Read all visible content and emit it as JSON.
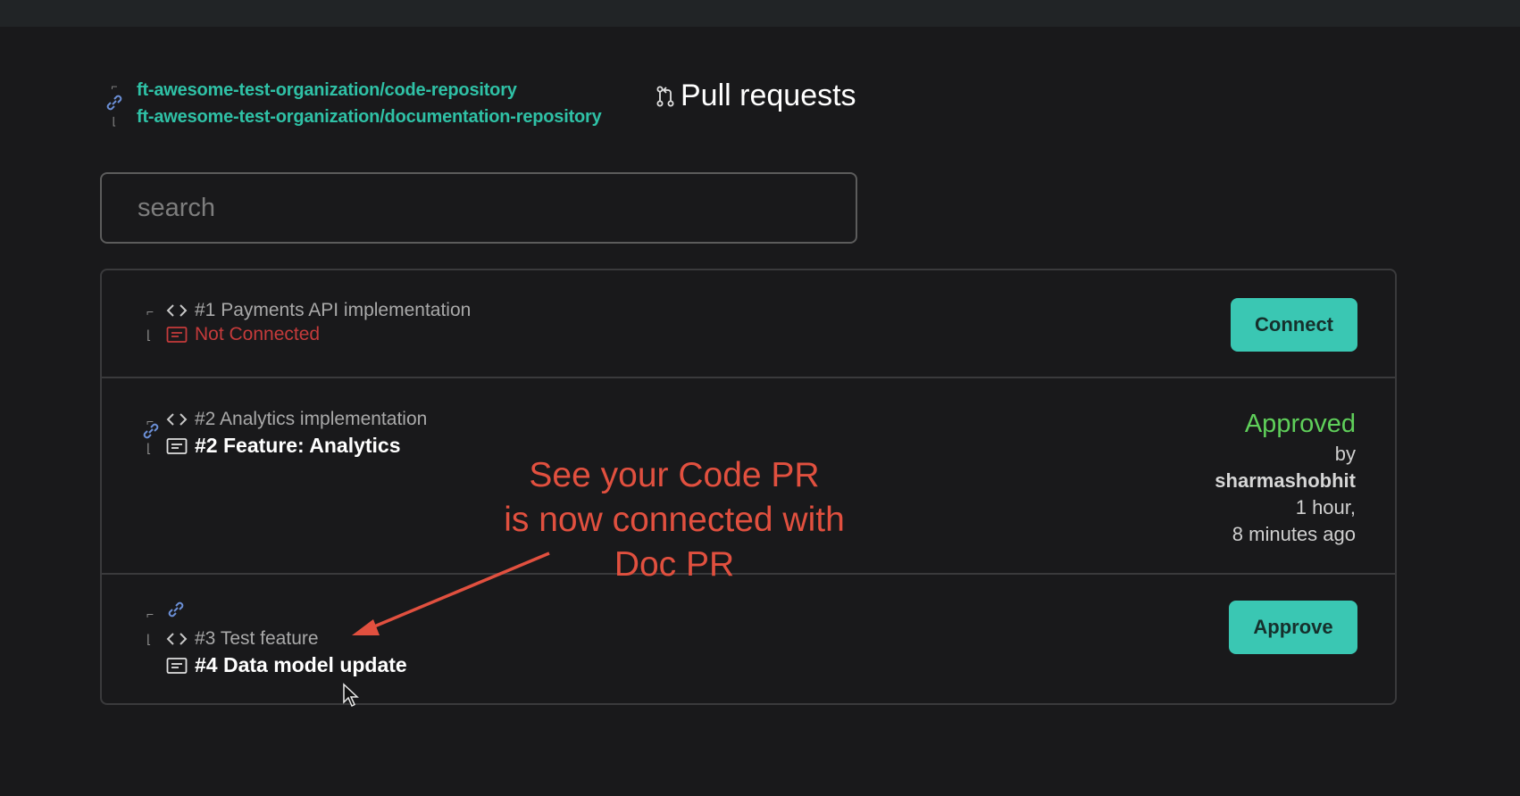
{
  "header": {
    "repos": [
      "ft-awesome-test-organization/code-repository",
      "ft-awesome-test-organization/documentation-repository"
    ],
    "title": "Pull requests"
  },
  "search": {
    "placeholder": "search"
  },
  "pull_requests": [
    {
      "code_pr": "#1 Payments API implementation",
      "status_text": "Not Connected",
      "action_label": "Connect"
    },
    {
      "code_pr": "#2 Analytics implementation",
      "doc_pr": "#2 Feature: Analytics",
      "review": {
        "status": "Approved",
        "by_label": "by",
        "approver": "sharmashobhit",
        "time_line1": "1 hour,",
        "time_line2": "8 minutes ago"
      }
    },
    {
      "code_pr": "#3 Test feature",
      "doc_pr": "#4 Data model update",
      "action_label": "Approve"
    }
  ],
  "annotation": {
    "lines": [
      "See your Code PR",
      "is now connected with",
      "Doc PR"
    ],
    "color": "#e1503f"
  },
  "colors": {
    "accent": "#3ac7b3",
    "repo_link": "#2fc1a6",
    "approved": "#5fcf5a",
    "not_connected": "#c53b3b",
    "background": "#19191b"
  },
  "icons": [
    "link-icon",
    "pull-request-icon",
    "code-icon",
    "document-icon",
    "cursor-icon"
  ]
}
